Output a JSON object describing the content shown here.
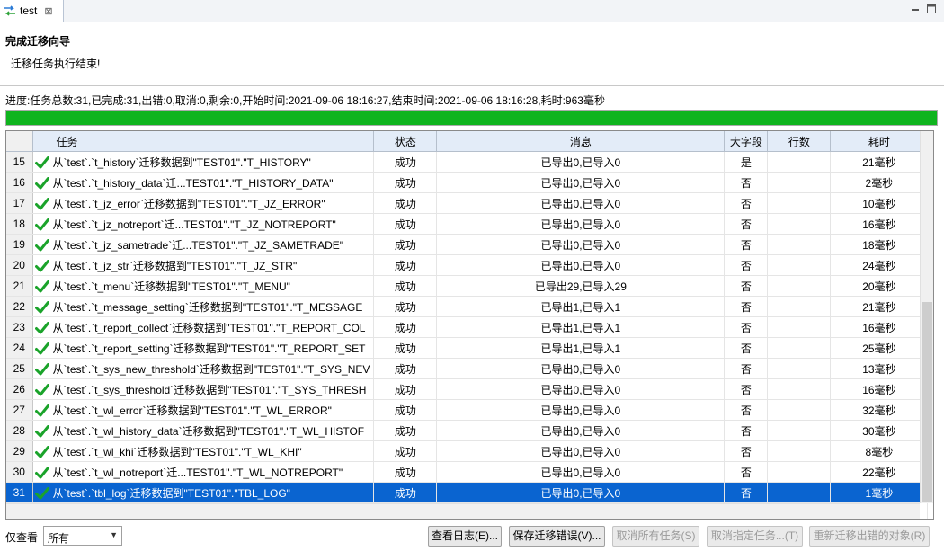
{
  "tab": {
    "label": "test",
    "close": "⊠"
  },
  "header": {
    "title": "完成迁移向导",
    "message": "迁移任务执行结束!"
  },
  "progress": {
    "text": "进度:任务总数:31,已完成:31,出错:0,取消:0,剩余:0,开始时间:2021-09-06 18:16:27,结束时间:2021-09-06 18:16:28,耗时:963毫秒",
    "fraction": 1.0,
    "color": "#0fb41e"
  },
  "table": {
    "columns": [
      "任务",
      "状态",
      "消息",
      "大字段",
      "行数",
      "耗时"
    ],
    "rows": [
      {
        "num": "15",
        "task": "从`test`.`t_history`迁移数据到\"TEST01\".\"T_HISTORY\"",
        "status": "成功",
        "msg": "已导出0,已导入0",
        "lob": "是",
        "rows": "",
        "time": "21毫秒"
      },
      {
        "num": "16",
        "task": "从`test`.`t_history_data`迁...TEST01\".\"T_HISTORY_DATA\"",
        "status": "成功",
        "msg": "已导出0,已导入0",
        "lob": "否",
        "rows": "",
        "time": "2毫秒"
      },
      {
        "num": "17",
        "task": "从`test`.`t_jz_error`迁移数据到\"TEST01\".\"T_JZ_ERROR\"",
        "status": "成功",
        "msg": "已导出0,已导入0",
        "lob": "否",
        "rows": "",
        "time": "10毫秒"
      },
      {
        "num": "18",
        "task": "从`test`.`t_jz_notreport`迁...TEST01\".\"T_JZ_NOTREPORT\"",
        "status": "成功",
        "msg": "已导出0,已导入0",
        "lob": "否",
        "rows": "",
        "time": "16毫秒"
      },
      {
        "num": "19",
        "task": "从`test`.`t_jz_sametrade`迁...TEST01\".\"T_JZ_SAMETRADE\"",
        "status": "成功",
        "msg": "已导出0,已导入0",
        "lob": "否",
        "rows": "",
        "time": "18毫秒"
      },
      {
        "num": "20",
        "task": "从`test`.`t_jz_str`迁移数据到\"TEST01\".\"T_JZ_STR\"",
        "status": "成功",
        "msg": "已导出0,已导入0",
        "lob": "否",
        "rows": "",
        "time": "24毫秒"
      },
      {
        "num": "21",
        "task": "从`test`.`t_menu`迁移数据到\"TEST01\".\"T_MENU\"",
        "status": "成功",
        "msg": "已导出29,已导入29",
        "lob": "否",
        "rows": "",
        "time": "20毫秒"
      },
      {
        "num": "22",
        "task": "从`test`.`t_message_setting`迁移数据到\"TEST01\".\"T_MESSAGE",
        "status": "成功",
        "msg": "已导出1,已导入1",
        "lob": "否",
        "rows": "",
        "time": "21毫秒"
      },
      {
        "num": "23",
        "task": "从`test`.`t_report_collect`迁移数据到\"TEST01\".\"T_REPORT_COL",
        "status": "成功",
        "msg": "已导出1,已导入1",
        "lob": "否",
        "rows": "",
        "time": "16毫秒"
      },
      {
        "num": "24",
        "task": "从`test`.`t_report_setting`迁移数据到\"TEST01\".\"T_REPORT_SET",
        "status": "成功",
        "msg": "已导出1,已导入1",
        "lob": "否",
        "rows": "",
        "time": "25毫秒"
      },
      {
        "num": "25",
        "task": "从`test`.`t_sys_new_threshold`迁移数据到\"TEST01\".\"T_SYS_NEV",
        "status": "成功",
        "msg": "已导出0,已导入0",
        "lob": "否",
        "rows": "",
        "time": "13毫秒"
      },
      {
        "num": "26",
        "task": "从`test`.`t_sys_threshold`迁移数据到\"TEST01\".\"T_SYS_THRESH",
        "status": "成功",
        "msg": "已导出0,已导入0",
        "lob": "否",
        "rows": "",
        "time": "16毫秒"
      },
      {
        "num": "27",
        "task": "从`test`.`t_wl_error`迁移数据到\"TEST01\".\"T_WL_ERROR\"",
        "status": "成功",
        "msg": "已导出0,已导入0",
        "lob": "否",
        "rows": "",
        "time": "32毫秒"
      },
      {
        "num": "28",
        "task": "从`test`.`t_wl_history_data`迁移数据到\"TEST01\".\"T_WL_HISTOF",
        "status": "成功",
        "msg": "已导出0,已导入0",
        "lob": "否",
        "rows": "",
        "time": "30毫秒"
      },
      {
        "num": "29",
        "task": "从`test`.`t_wl_khi`迁移数据到\"TEST01\".\"T_WL_KHI\"",
        "status": "成功",
        "msg": "已导出0,已导入0",
        "lob": "否",
        "rows": "",
        "time": "8毫秒"
      },
      {
        "num": "30",
        "task": "从`test`.`t_wl_notreport`迁...TEST01\".\"T_WL_NOTREPORT\"",
        "status": "成功",
        "msg": "已导出0,已导入0",
        "lob": "否",
        "rows": "",
        "time": "22毫秒"
      },
      {
        "num": "31",
        "task": "从`test`.`tbl_log`迁移数据到\"TEST01\".\"TBL_LOG\"",
        "status": "成功",
        "msg": "已导出0,已导入0",
        "lob": "否",
        "rows": "",
        "time": "1毫秒",
        "selected": true
      }
    ]
  },
  "filter": {
    "label": "仅查看",
    "value": "所有"
  },
  "buttons": {
    "view_log": "查看日志(E)...",
    "save_errors": "保存迁移错误(V)...",
    "cancel_all": "取消所有任务(S)",
    "cancel_selected": "取消指定任务...(T)",
    "remigrate": "重新迁移出错的对象(R)"
  }
}
